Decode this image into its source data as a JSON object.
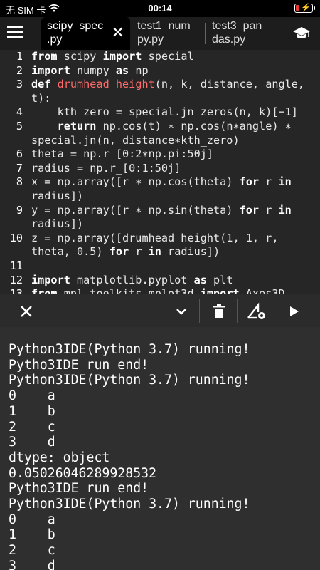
{
  "status_bar": {
    "carrier": "无 SIM 卡",
    "time": "00:14"
  },
  "tabs": [
    {
      "label_line1": "scipy_spec",
      "label_line2": ".py",
      "active": true
    },
    {
      "label_line1": "test1_num",
      "label_line2": "py.py",
      "active": false
    },
    {
      "label_line1": "test3_pan",
      "label_line2": "das.py",
      "active": false
    }
  ],
  "icons": {
    "menu": "hamburger-menu-icon",
    "close_tab": "close-icon",
    "learn": "graduation-cap-icon",
    "close_console": "close-icon",
    "collapse": "chevron-down-icon",
    "delete": "trash-icon",
    "settings": "triangle-gear-icon",
    "run": "play-icon"
  },
  "editor": {
    "lines": [
      {
        "n": "1",
        "segments": [
          {
            "t": "from",
            "c": "kw"
          },
          {
            "t": " scipy ",
            "c": ""
          },
          {
            "t": "import",
            "c": "kw"
          },
          {
            "t": " special",
            "c": ""
          }
        ]
      },
      {
        "n": "2",
        "segments": [
          {
            "t": "import",
            "c": "kw"
          },
          {
            "t": " numpy ",
            "c": ""
          },
          {
            "t": "as",
            "c": "kw"
          },
          {
            "t": " np",
            "c": ""
          }
        ]
      },
      {
        "n": "3",
        "segments": [
          {
            "t": "def",
            "c": "kw"
          },
          {
            "t": " ",
            "c": ""
          },
          {
            "t": "drumhead_height",
            "c": "fn"
          },
          {
            "t": "(n, k, distance, angle, t):",
            "c": ""
          }
        ]
      },
      {
        "n": "4",
        "segments": [
          {
            "t": "    kth_zero = special.jn_zeros(n, k)[−1]",
            "c": ""
          }
        ]
      },
      {
        "n": "5",
        "segments": [
          {
            "t": "    ",
            "c": ""
          },
          {
            "t": "return",
            "c": "kw"
          },
          {
            "t": " np.cos(t) ∗ np.cos(n∗angle) ∗ special.jn(n, distance∗kth_zero)",
            "c": ""
          }
        ]
      },
      {
        "n": "6",
        "segments": [
          {
            "t": "theta = np.r_[0:2∗np.pi:50j]",
            "c": ""
          }
        ]
      },
      {
        "n": "7",
        "segments": [
          {
            "t": "radius = np.r_[0:1:50j]",
            "c": ""
          }
        ]
      },
      {
        "n": "8",
        "segments": [
          {
            "t": "x = np.array([r ∗ np.cos(theta) ",
            "c": ""
          },
          {
            "t": "for",
            "c": "kw"
          },
          {
            "t": " r ",
            "c": ""
          },
          {
            "t": "in",
            "c": "kw"
          },
          {
            "t": " radius])",
            "c": ""
          }
        ]
      },
      {
        "n": "9",
        "segments": [
          {
            "t": "y = np.array([r ∗ np.sin(theta) ",
            "c": ""
          },
          {
            "t": "for",
            "c": "kw"
          },
          {
            "t": " r ",
            "c": ""
          },
          {
            "t": "in",
            "c": "kw"
          },
          {
            "t": " radius])",
            "c": ""
          }
        ]
      },
      {
        "n": "10",
        "segments": [
          {
            "t": "z = np.array([drumhead_height(1, 1, r, theta, 0.5) ",
            "c": ""
          },
          {
            "t": "for",
            "c": "kw"
          },
          {
            "t": " r ",
            "c": ""
          },
          {
            "t": "in",
            "c": "kw"
          },
          {
            "t": " radius])",
            "c": ""
          }
        ]
      },
      {
        "n": "11",
        "segments": [
          {
            "t": "",
            "c": ""
          }
        ]
      },
      {
        "n": "12",
        "segments": [
          {
            "t": "import",
            "c": "kw"
          },
          {
            "t": " matplotlib.pyplot ",
            "c": ""
          },
          {
            "t": "as",
            "c": "kw"
          },
          {
            "t": " plt",
            "c": ""
          }
        ]
      },
      {
        "n": "13",
        "segments": [
          {
            "t": "from",
            "c": "kw"
          },
          {
            "t": " mpl_toolkits.mplot3d ",
            "c": ""
          },
          {
            "t": "import",
            "c": "kw"
          },
          {
            "t": " Axes3D",
            "c": ""
          }
        ]
      }
    ]
  },
  "console": {
    "lines": [
      "Python3IDE(Python 3.7) running!",
      "Pytho3IDE run end!",
      "Python3IDE(Python 3.7) running!",
      "0    a",
      "1    b",
      "2    c",
      "3    d",
      "dtype: object",
      "0.05026046289928532",
      "Pytho3IDE run end!",
      "Python3IDE(Python 3.7) running!",
      "0    a",
      "1    b",
      "2    c",
      "3    d"
    ]
  }
}
